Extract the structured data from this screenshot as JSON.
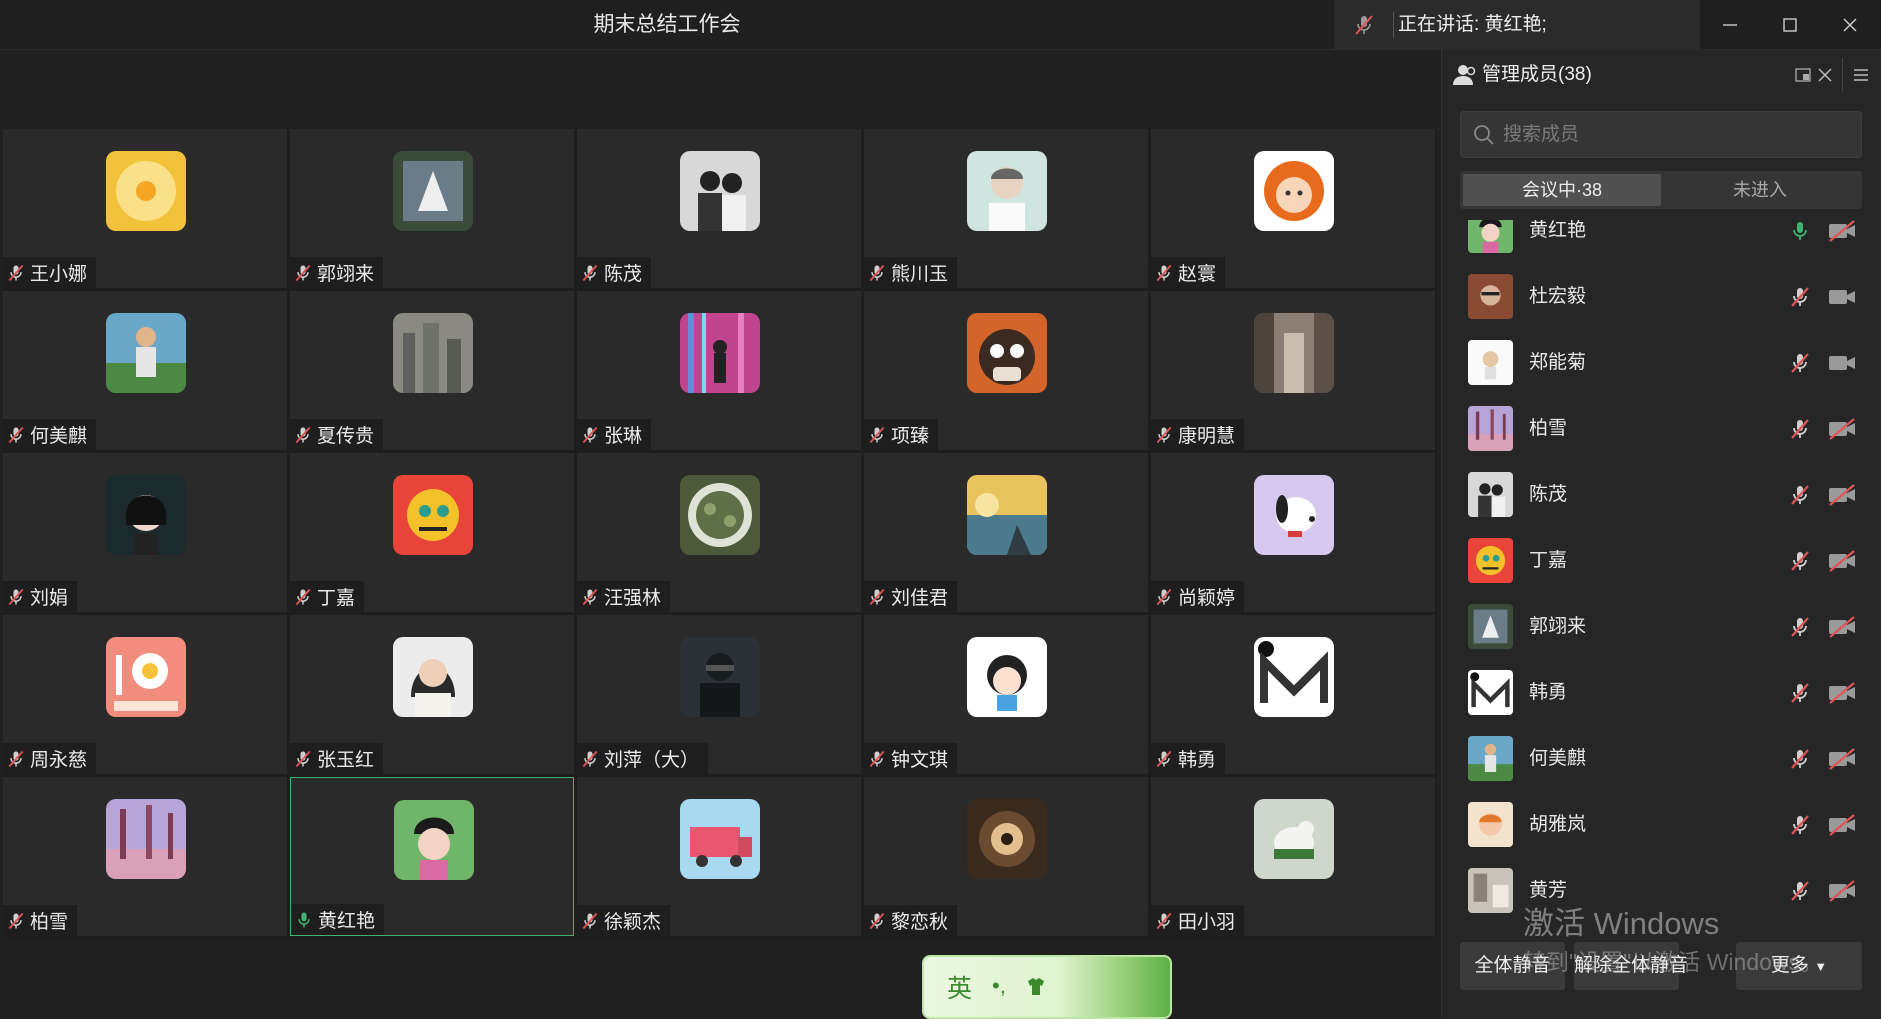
{
  "titlebar": {
    "meeting_title": "期末总结工作会",
    "speaking_label": "正在讲话: 黄红艳;",
    "minimize_icon": "minimize-icon",
    "maximize_icon": "maximize-icon",
    "close_icon": "close-icon"
  },
  "grid": {
    "tiles": [
      {
        "name": "王小娜",
        "mic": "muted",
        "avatar": "flower-yellow"
      },
      {
        "name": "郭翊来",
        "mic": "muted",
        "avatar": "unicorn-art"
      },
      {
        "name": "陈茂",
        "mic": "muted",
        "avatar": "couple-photo"
      },
      {
        "name": "熊川玉",
        "mic": "muted",
        "avatar": "portrait-boy"
      },
      {
        "name": "赵寰",
        "mic": "muted",
        "avatar": "cartoon-girl"
      },
      {
        "name": "何美麒",
        "mic": "muted",
        "avatar": "girl-field"
      },
      {
        "name": "夏传贵",
        "mic": "muted",
        "avatar": "city-grey"
      },
      {
        "name": "张琳",
        "mic": "muted",
        "avatar": "pink-neon"
      },
      {
        "name": "项臻",
        "mic": "muted",
        "avatar": "cat-mask"
      },
      {
        "name": "康明慧",
        "mic": "muted",
        "avatar": "alley"
      },
      {
        "name": "刘娟",
        "mic": "muted",
        "avatar": "anime-girl"
      },
      {
        "name": "丁嘉",
        "mic": "muted",
        "avatar": "lion-art"
      },
      {
        "name": "汪强林",
        "mic": "muted",
        "avatar": "aerial-circle"
      },
      {
        "name": "刘佳君",
        "mic": "muted",
        "avatar": "sunset-lake"
      },
      {
        "name": "尚颖婷",
        "mic": "muted",
        "avatar": "snoopy"
      },
      {
        "name": "周永慈",
        "mic": "muted",
        "avatar": "be-yourself"
      },
      {
        "name": "张玉红",
        "mic": "muted",
        "avatar": "woman-glasses"
      },
      {
        "name": "刘萍（大）",
        "mic": "muted",
        "avatar": "dark-figure"
      },
      {
        "name": "钟文琪",
        "mic": "muted",
        "avatar": "cartoon-kid"
      },
      {
        "name": "韩勇",
        "mic": "muted",
        "avatar": "m-logo"
      },
      {
        "name": "柏雪",
        "mic": "muted",
        "avatar": "pink-trees"
      },
      {
        "name": "黄红艳",
        "mic": "active",
        "avatar": "woman-hat",
        "active": true
      },
      {
        "name": "徐颖杰",
        "mic": "muted",
        "avatar": "pink-truck"
      },
      {
        "name": "黎恋秋",
        "mic": "muted",
        "avatar": "chandelier"
      },
      {
        "name": "田小羽",
        "mic": "muted",
        "avatar": "white-bird"
      }
    ]
  },
  "sidebar": {
    "title": "管理成员(38)",
    "search_placeholder": "搜索成员",
    "tab_in_meeting": "会议中·38",
    "tab_not_joined": "未进入",
    "members": [
      {
        "name": "黄红艳",
        "mic": "active",
        "cam": "off",
        "avatar": "woman-hat"
      },
      {
        "name": "杜宏毅",
        "mic": "muted",
        "cam": "on",
        "avatar": "man-photo"
      },
      {
        "name": "郑能菊",
        "mic": "muted",
        "cam": "on",
        "avatar": "cartoon-small"
      },
      {
        "name": "柏雪",
        "mic": "muted",
        "cam": "off",
        "avatar": "pink-trees"
      },
      {
        "name": "陈茂",
        "mic": "muted",
        "cam": "off",
        "avatar": "couple-photo"
      },
      {
        "name": "丁嘉",
        "mic": "muted",
        "cam": "off",
        "avatar": "lion-art"
      },
      {
        "name": "郭翊来",
        "mic": "muted",
        "cam": "off",
        "avatar": "unicorn-art"
      },
      {
        "name": "韩勇",
        "mic": "muted",
        "cam": "off",
        "avatar": "m-logo"
      },
      {
        "name": "何美麒",
        "mic": "muted",
        "cam": "off",
        "avatar": "girl-field"
      },
      {
        "name": "胡雅岚",
        "mic": "muted",
        "cam": "off",
        "avatar": "baby-photo"
      },
      {
        "name": "黄芳",
        "mic": "muted",
        "cam": "off",
        "avatar": "room-photo"
      }
    ],
    "mute_all": "全体静音",
    "unmute_all": "解除全体静音",
    "more": "更多"
  },
  "watermark": {
    "line1": "激活 Windows",
    "line2": "转到\"设置\"以激活 Windows。"
  },
  "ime": {
    "lang": "英"
  },
  "colors": {
    "accent_green": "#3fb170",
    "muted_red": "#e05555",
    "background": "#202020"
  }
}
